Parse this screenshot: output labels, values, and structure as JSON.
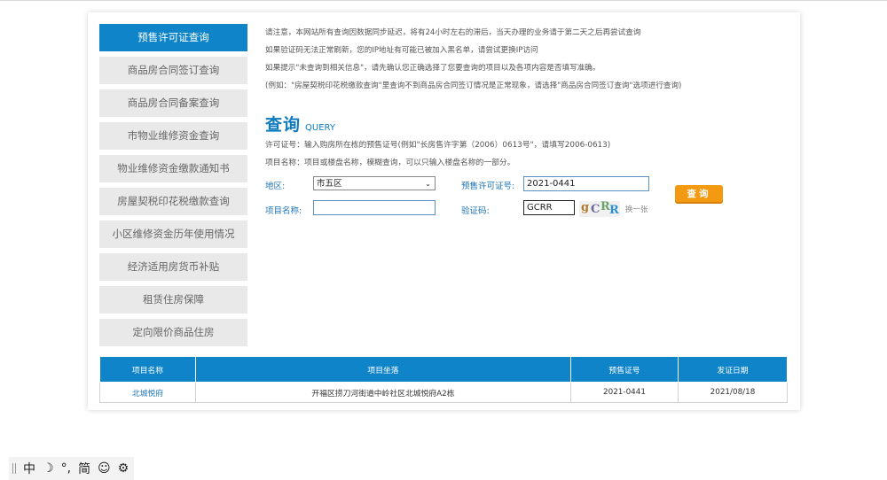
{
  "sidebar": {
    "items": [
      {
        "label": "预售许可证查询",
        "active": true
      },
      {
        "label": "商品房合同签订查询"
      },
      {
        "label": "商品房合同备案查询"
      },
      {
        "label": "市物业维修资金查询"
      },
      {
        "label": "物业维修资金缴款通知书"
      },
      {
        "label": "房屋契税印花税缴款查询"
      },
      {
        "label": "小区维修资金历年使用情况"
      },
      {
        "label": "经济适用房货币补贴"
      },
      {
        "label": "租赁住房保障"
      },
      {
        "label": "定向限价商品住房"
      }
    ]
  },
  "notes": [
    "请注意，本网站所有查询因数据同步延迟，将有24小时左右的滞后，当天办理的业务请于第二天之后再尝试查询",
    "如果验证码无法正常刷新，您的IP地址有可能已被加入黑名单，请尝试更换IP访问",
    "如果提示\"未查询到相关信息\"，请先确认您正确选择了您要查询的项目以及各项内容是否填写准确。",
    "(例如：\"房屋契税印花税缴款查询\"里查询不到商品房合同签订情况是正常现象，请选择\"商品房合同签订查询\"选项进行查询)"
  ],
  "query": {
    "title_cn": "查询",
    "title_en": "QUERY",
    "hint_permit": "许可证号：输入购房所在栋的预售证号(例如\"长房售许字第（2006）0613号\"，请填写2006-0613)",
    "hint_project": "项目名称：项目或楼盘名称，模糊查询，可以只输入楼盘名称的一部分。"
  },
  "form": {
    "district_label": "地区:",
    "district_value": "市五区",
    "permit_label": "预售许可证号:",
    "permit_value": "2021-0441",
    "project_label": "项目名称:",
    "project_value": "",
    "captcha_label": "验证码:",
    "captcha_value": "GCRR",
    "captcha_chars": [
      "g",
      "C",
      "R",
      "R"
    ],
    "refresh_label": "换一张",
    "submit_label": "查询"
  },
  "table": {
    "headers": [
      "项目名称",
      "项目坐落",
      "预售证号",
      "发证日期"
    ],
    "rows": [
      [
        "北城悦府",
        "开福区捞刀河街道中岭社区北城悦府A2栋",
        "2021-0441",
        "2021/08/18"
      ]
    ]
  },
  "ime": {
    "items": [
      "中",
      "☽",
      "°,",
      "简",
      "☺",
      "⚙"
    ]
  },
  "colors": {
    "accent": "#0f84c8",
    "button": "#f39a12",
    "sidebar_bg": "#e9e9e9"
  }
}
